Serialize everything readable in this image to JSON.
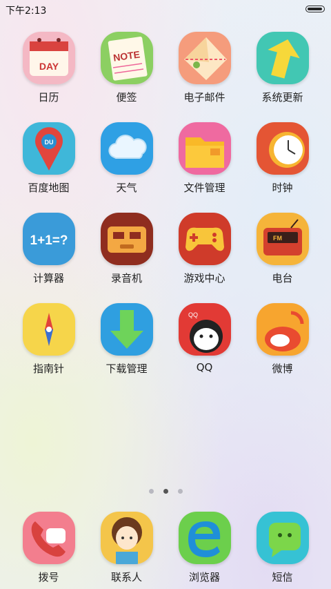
{
  "status_bar": {
    "time": "下午2:13",
    "battery_level": 0.85
  },
  "apps": [
    {
      "label": "日历",
      "icon": "calendar-icon",
      "icon_text": "DAY"
    },
    {
      "label": "便签",
      "icon": "notes-icon",
      "icon_text": "NOTE"
    },
    {
      "label": "电子邮件",
      "icon": "email-icon"
    },
    {
      "label": "系统更新",
      "icon": "system-update-icon"
    },
    {
      "label": "百度地图",
      "icon": "baidu-map-icon",
      "icon_text": "DU"
    },
    {
      "label": "天气",
      "icon": "weather-icon"
    },
    {
      "label": "文件管理",
      "icon": "file-manager-icon"
    },
    {
      "label": "时钟",
      "icon": "clock-icon"
    },
    {
      "label": "计算器",
      "icon": "calculator-icon",
      "icon_text": "1+1=?"
    },
    {
      "label": "录音机",
      "icon": "recorder-icon"
    },
    {
      "label": "游戏中心",
      "icon": "game-center-icon"
    },
    {
      "label": "电台",
      "icon": "radio-icon",
      "icon_text": "FM"
    },
    {
      "label": "指南针",
      "icon": "compass-icon"
    },
    {
      "label": "下载管理",
      "icon": "download-manager-icon"
    },
    {
      "label": "QQ",
      "icon": "qq-icon",
      "icon_text": "QQ"
    },
    {
      "label": "微博",
      "icon": "weibo-icon"
    }
  ],
  "page_indicator": {
    "pages": 3,
    "current": 2
  },
  "dock": [
    {
      "label": "拨号",
      "icon": "phone-icon"
    },
    {
      "label": "联系人",
      "icon": "contacts-icon"
    },
    {
      "label": "浏览器",
      "icon": "browser-icon"
    },
    {
      "label": "短信",
      "icon": "messages-icon"
    }
  ]
}
